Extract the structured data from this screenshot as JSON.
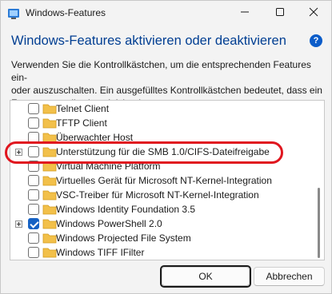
{
  "window": {
    "title": "Windows-Features",
    "icon": "control-panel-icon",
    "controls": [
      "minimize-icon",
      "maximize-icon",
      "close-icon"
    ]
  },
  "heading": "Windows-Features aktivieren oder deaktivieren",
  "help_icon": "help-icon",
  "description_lines": [
    "Verwenden Sie die Kontrollkästchen, um die entsprechenden Features ein-",
    "oder auszuschalten. Ein ausgefülltes Kontrollkästchen bedeutet, dass ein",
    "Feature nur teilweise aktiviert ist."
  ],
  "features": [
    {
      "label": "Telnet Client",
      "checked": false,
      "expandable": false
    },
    {
      "label": "TFTP Client",
      "checked": false,
      "expandable": false
    },
    {
      "label": "Überwachter Host",
      "checked": false,
      "expandable": false
    },
    {
      "label": "Unterstützung für die SMB 1.0/CIFS-Dateifreigabe",
      "checked": false,
      "expandable": true,
      "highlighted": true
    },
    {
      "label": "Virtual Machine Platform",
      "checked": false,
      "expandable": false
    },
    {
      "label": "Virtuelles Gerät für Microsoft NT-Kernel-Integration",
      "checked": false,
      "expandable": false
    },
    {
      "label": "VSC-Treiber für Microsoft NT-Kernel-Integration",
      "checked": false,
      "expandable": false
    },
    {
      "label": "Windows Identity Foundation 3.5",
      "checked": false,
      "expandable": false
    },
    {
      "label": "Windows PowerShell 2.0",
      "checked": true,
      "expandable": true
    },
    {
      "label": "Windows Projected File System",
      "checked": false,
      "expandable": false
    },
    {
      "label": "Windows TIFF IFilter",
      "checked": false,
      "expandable": false
    }
  ],
  "buttons": {
    "ok": "OK",
    "cancel": "Abbrechen"
  },
  "colors": {
    "heading": "#003e92",
    "checkbox_checked": "#1662c4",
    "highlight_annotation": "#e0161f",
    "folder": "#f2c04a"
  }
}
